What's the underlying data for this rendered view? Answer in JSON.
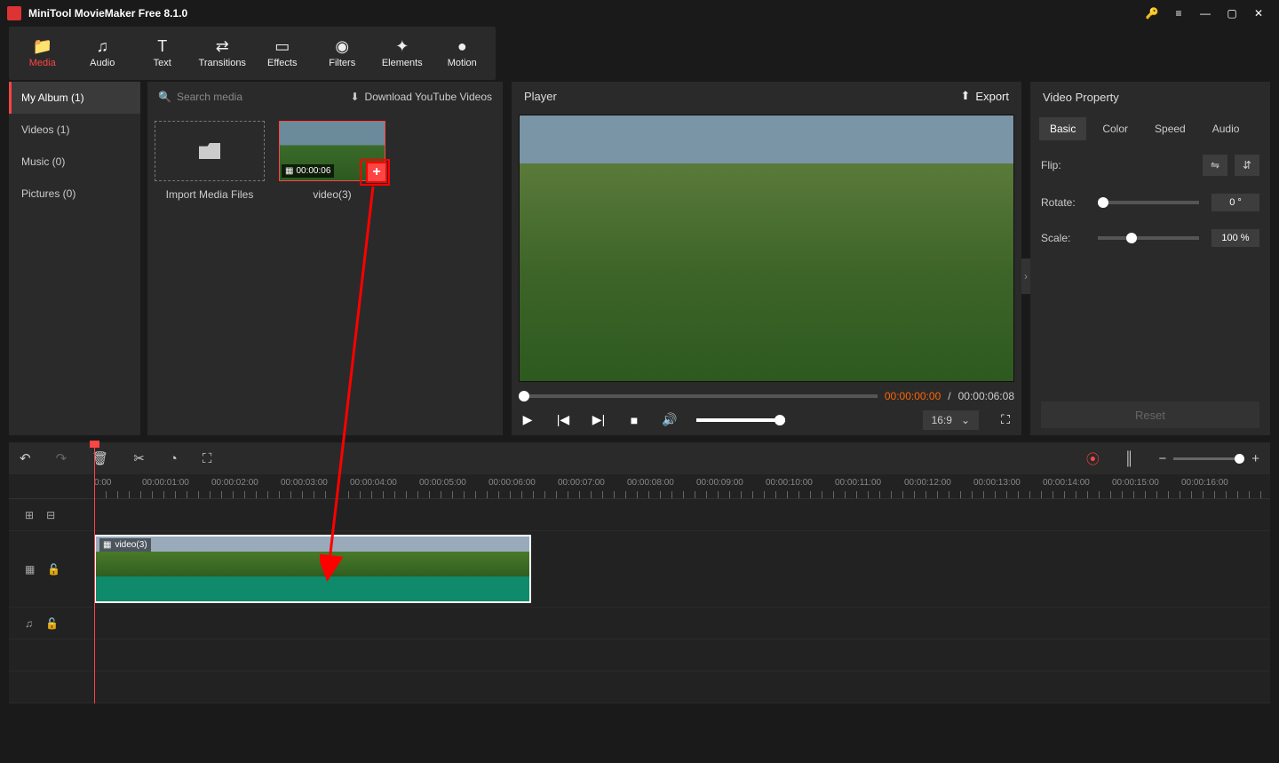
{
  "app": {
    "title": "MiniTool MovieMaker Free 8.1.0"
  },
  "tabs": [
    {
      "label": "Media",
      "icon": "📁"
    },
    {
      "label": "Audio",
      "icon": "♫"
    },
    {
      "label": "Text",
      "icon": "T"
    },
    {
      "label": "Transitions",
      "icon": "⇄"
    },
    {
      "label": "Effects",
      "icon": "▭"
    },
    {
      "label": "Filters",
      "icon": "◉"
    },
    {
      "label": "Elements",
      "icon": "✦"
    },
    {
      "label": "Motion",
      "icon": "●"
    }
  ],
  "sidebar": [
    {
      "label": "My Album (1)"
    },
    {
      "label": "Videos (1)"
    },
    {
      "label": "Music (0)"
    },
    {
      "label": "Pictures (0)"
    }
  ],
  "mediabar": {
    "search_placeholder": "Search media",
    "download": "Download YouTube Videos"
  },
  "media_items": {
    "import_label": "Import Media Files",
    "clip_duration": "00:00:06",
    "clip_name": "video(3)"
  },
  "player": {
    "title": "Player",
    "export": "Export",
    "time_current": "00:00:00:00",
    "time_sep": " / ",
    "time_total": "00:00:06:08",
    "aspect": "16:9"
  },
  "props": {
    "title": "Video Property",
    "tabs": [
      "Basic",
      "Color",
      "Speed",
      "Audio"
    ],
    "flip_label": "Flip:",
    "rotate_label": "Rotate:",
    "rotate_value": "0 °",
    "scale_label": "Scale:",
    "scale_value": "100 %",
    "reset": "Reset"
  },
  "timeline": {
    "marks": [
      "0:00",
      "00:00:01:00",
      "00:00:02:00",
      "00:00:03:00",
      "00:00:04:00",
      "00:00:05:00",
      "00:00:06:00",
      "00:00:07:00",
      "00:00:08:00",
      "00:00:09:00",
      "00:00:10:00",
      "00:00:11:00",
      "00:00:12:00",
      "00:00:13:00",
      "00:00:14:00",
      "00:00:15:00",
      "00:00:16:00"
    ],
    "clip_name": "video(3)"
  }
}
